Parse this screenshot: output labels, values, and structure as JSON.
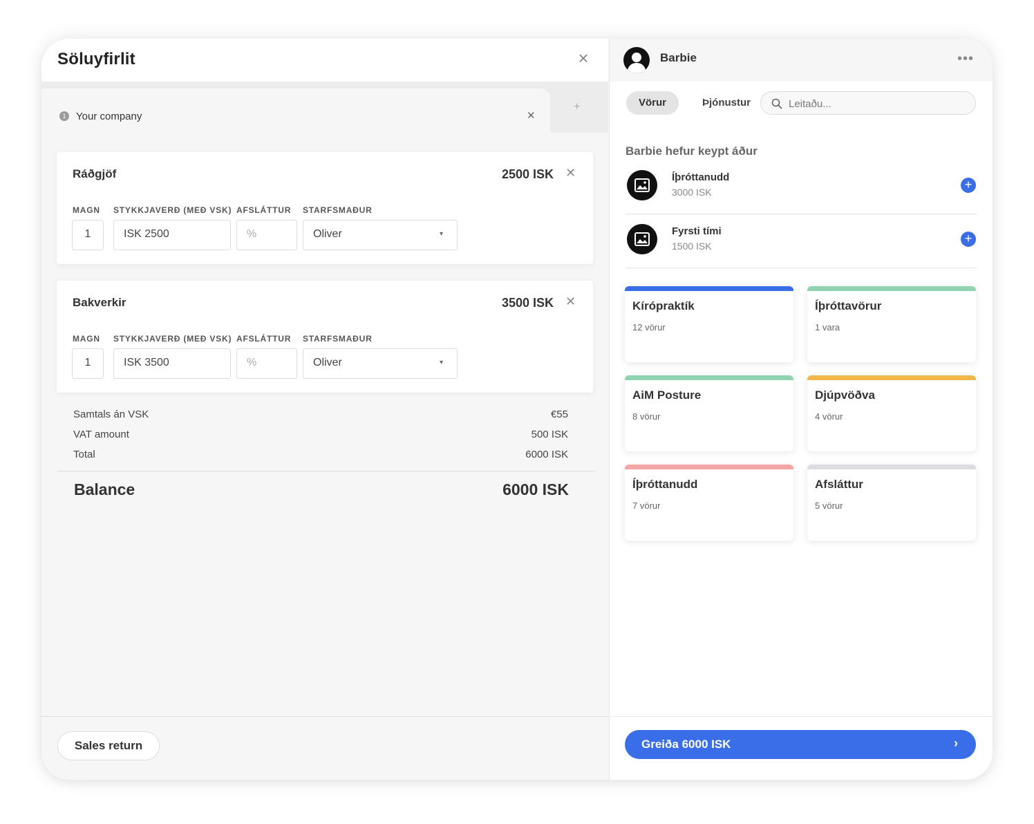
{
  "sale": {
    "title": "Söluyfirlit",
    "tab": {
      "number": "1",
      "label": "Your company"
    },
    "field_labels": {
      "qty": "MAGN",
      "price": "STYKKJAVERÐ (MEÐ VSK)",
      "discount": "AFSLÁTTUR",
      "employee": "STARFSMAÐUR"
    },
    "items": [
      {
        "name": "Ráðgjöf",
        "total": "2500 ISK",
        "qty": "1",
        "unit_price": "ISK 2500",
        "discount_placeholder": "%",
        "employee": "Oliver"
      },
      {
        "name": "Bakverkir",
        "total": "3500 ISK",
        "qty": "1",
        "unit_price": "ISK 3500",
        "discount_placeholder": "%",
        "employee": "Oliver"
      }
    ],
    "totals": [
      {
        "label": "Samtals án VSK",
        "value": "€55"
      },
      {
        "label": "VAT amount",
        "value": "500 ISK"
      },
      {
        "label": "Total",
        "value": "6000 ISK"
      }
    ],
    "balance": {
      "label": "Balance",
      "value": "6000 ISK"
    },
    "sales_return_label": "Sales return"
  },
  "customer": {
    "name": "Barbie",
    "segments": {
      "active": "Vörur",
      "other": "Þjónustur"
    },
    "search_placeholder": "Leitaðu...",
    "previous_title": "Barbie hefur keypt áður",
    "previous": [
      {
        "name": "Íþróttanudd",
        "price": "3000 ISK"
      },
      {
        "name": "Fyrsti tími",
        "price": "1500 ISK"
      }
    ],
    "categories": [
      {
        "name": "Kírópraktík",
        "count": "12 vörur",
        "color": "#3a6ee8"
      },
      {
        "name": "Íþróttavörur",
        "count": "1 vara",
        "color": "#8fd3b0"
      },
      {
        "name": "AiM Posture",
        "count": "8 vörur",
        "color": "#8fd3b0"
      },
      {
        "name": "Djúpvöðva",
        "count": "4 vörur",
        "color": "#f0b84a"
      },
      {
        "name": "Íþróttanudd",
        "count": "7 vörur",
        "color": "#f2a6a6"
      },
      {
        "name": "Afsláttur",
        "count": "5 vörur",
        "color": "#dcdce2"
      }
    ],
    "pay_label": "Greiða 6000 ISK"
  },
  "colors": {
    "accent": "#3a6ee8",
    "background": "#f6f6f6"
  }
}
